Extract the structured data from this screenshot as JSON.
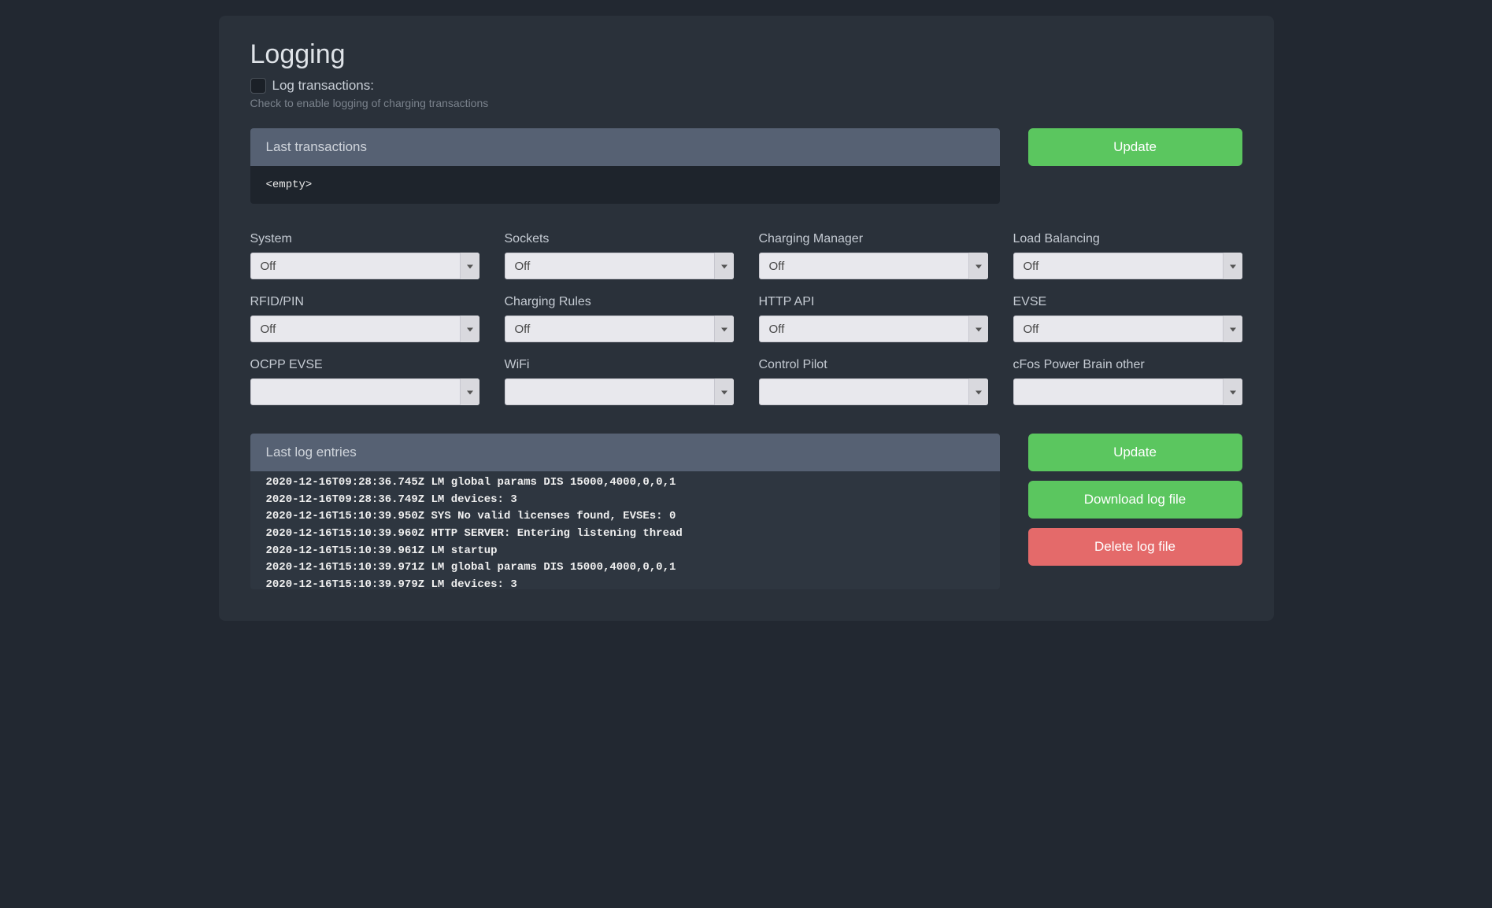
{
  "title": "Logging",
  "checkbox": {
    "label": "Log transactions:",
    "help": "Check to enable logging of charging transactions"
  },
  "transactions": {
    "header": "Last transactions",
    "body": "<empty>"
  },
  "buttons": {
    "update": "Update",
    "update2": "Update",
    "download": "Download log file",
    "delete": "Delete log file"
  },
  "selects": [
    {
      "label": "System",
      "value": "Off"
    },
    {
      "label": "Sockets",
      "value": "Off"
    },
    {
      "label": "Charging Manager",
      "value": "Off"
    },
    {
      "label": "Load Balancing",
      "value": "Off"
    },
    {
      "label": "RFID/PIN",
      "value": "Off"
    },
    {
      "label": "Charging Rules",
      "value": "Off"
    },
    {
      "label": "HTTP API",
      "value": "Off"
    },
    {
      "label": "EVSE",
      "value": "Off"
    },
    {
      "label": "OCPP EVSE",
      "value": ""
    },
    {
      "label": "WiFi",
      "value": ""
    },
    {
      "label": "Control Pilot",
      "value": ""
    },
    {
      "label": "cFos Power Brain other",
      "value": ""
    }
  ],
  "log": {
    "header": "Last log entries",
    "lines": [
      "2020-12-16T09:28:36.745Z LM global params DIS 15000,4000,0,0,1",
      "2020-12-16T09:28:36.749Z LM devices: 3",
      "2020-12-16T15:10:39.950Z SYS No valid licenses found, EVSEs: 0",
      "2020-12-16T15:10:39.960Z HTTP SERVER: Entering listening thread",
      "2020-12-16T15:10:39.961Z LM startup",
      "2020-12-16T15:10:39.971Z LM global params DIS 15000,4000,0,0,1",
      "2020-12-16T15:10:39.979Z LM devices: 3"
    ]
  }
}
